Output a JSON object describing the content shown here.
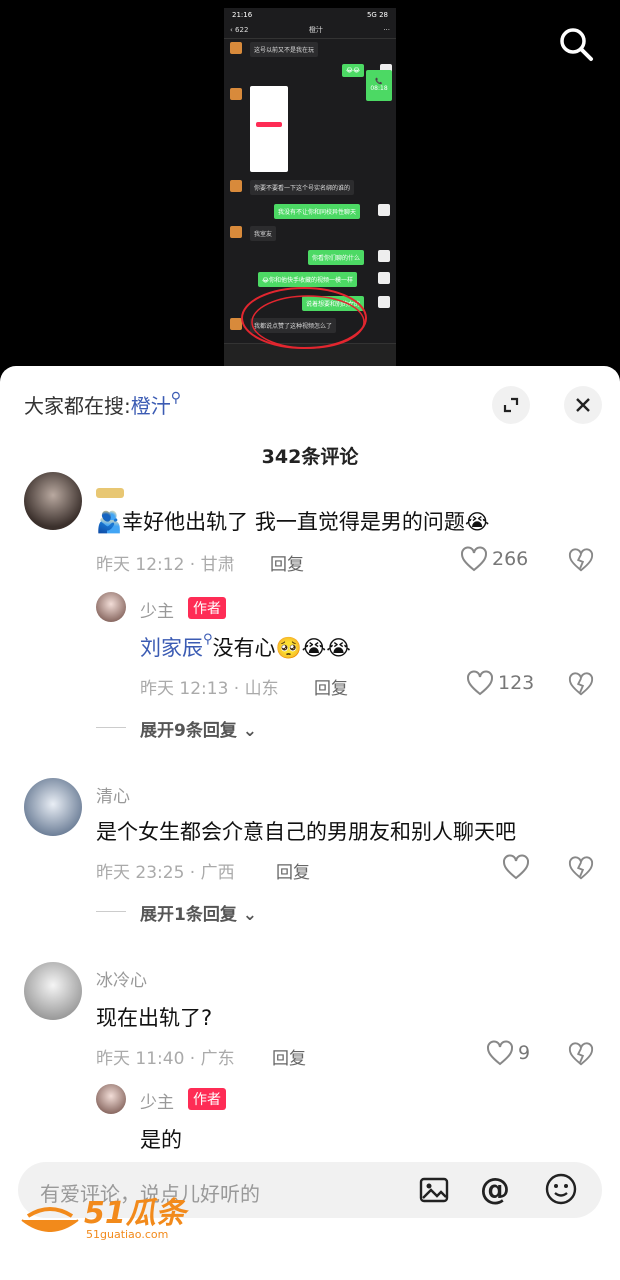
{
  "video": {
    "phone_status": {
      "time": "21:16",
      "signal": "5G",
      "battery": "28"
    },
    "chat": {
      "back_count": "622",
      "title": "橙汁",
      "messages": [
        {
          "side": "left",
          "text": "这号以前又不是我在玩"
        },
        {
          "side": "right",
          "text": "😂😂"
        },
        {
          "side": "right-call",
          "text": "08:18"
        },
        {
          "side": "left",
          "text": "你要不要看一下这个号实名绑的谁的"
        },
        {
          "side": "right",
          "text": "我没有不让你和同校异性聊天"
        },
        {
          "side": "left",
          "text": "我室友"
        },
        {
          "side": "right",
          "text": "你看你们聊的什么"
        },
        {
          "side": "right",
          "text": "😂你和他快手收藏的视频一模一样"
        },
        {
          "side": "right",
          "text": "说着想要和别的女的"
        },
        {
          "side": "left",
          "text": "我都说点赞了这种视频怎么了"
        }
      ]
    }
  },
  "sheet": {
    "search_prefix": "大家都在搜:",
    "search_term": "橙汁",
    "comment_count": "342条评论"
  },
  "comments": [
    {
      "text": "🫂幸好他出轨了 我一直觉得是男的问题😭",
      "time": "昨天 12:12 · 甘肃",
      "reply_label": "回复",
      "likes": "266",
      "reply": {
        "name": "少主",
        "badge": "作者",
        "mention": "刘家辰",
        "text": "没有心🥺😭😭",
        "time": "昨天 12:13 · 山东",
        "reply_label": "回复",
        "likes": "123"
      },
      "expand": "展开9条回复"
    },
    {
      "name": "清心",
      "text": "是个女生都会介意自己的男朋友和别人聊天吧",
      "time": "昨天 23:25 · 广西",
      "reply_label": "回复",
      "expand": "展开1条回复"
    },
    {
      "name": "冰冷心",
      "text": "现在出轨了?",
      "time": "昨天 11:40 · 广东",
      "reply_label": "回复",
      "likes": "9",
      "reply": {
        "name": "少主",
        "badge": "作者",
        "text": "是的"
      }
    }
  ],
  "input": {
    "placeholder": "有爱评论，说点儿好听的"
  },
  "watermark": {
    "brand": "51瓜条",
    "url": "51guatiao.com"
  },
  "colors": {
    "accent": "#fe2c55",
    "link": "#3b5bb3",
    "chat_green": "#4cd964"
  }
}
